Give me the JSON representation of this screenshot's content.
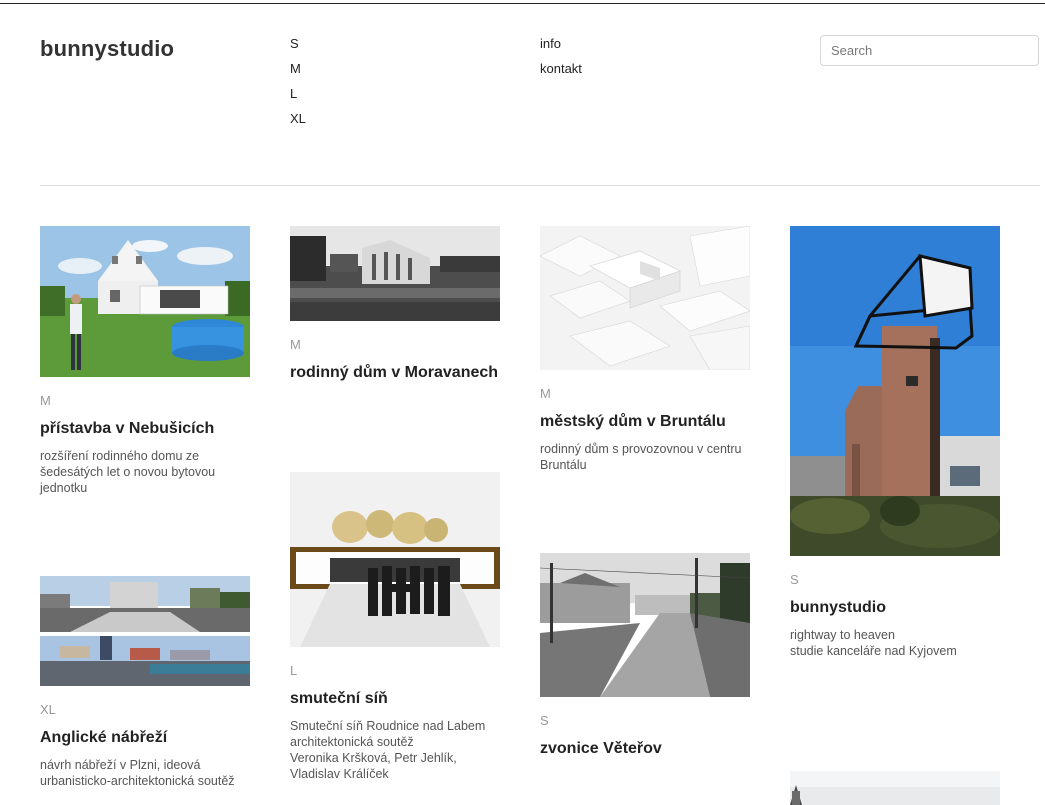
{
  "header": {
    "logo": "bunnystudio",
    "sizes_nav": [
      "S",
      "M",
      "L",
      "XL"
    ],
    "info_nav": [
      "info",
      "kontakt"
    ],
    "search_placeholder": "Search"
  },
  "projects": [
    {
      "size": "M",
      "title": "přístavba v Nebušicích",
      "description": "rozšíření rodinného domu ze šedesátých let o novou bytovou jednotku"
    },
    {
      "size": "M",
      "title": "rodinný dům v Moravanech",
      "description": ""
    },
    {
      "size": "M",
      "title": "městský dům v Bruntálu",
      "description": "rodinný dům s provozovnou v centru Bruntálu"
    },
    {
      "size": "S",
      "title": "bunnystudio",
      "description": "rightway to heaven\nstudie kanceláře nad Kyjovem"
    },
    {
      "size": "XL",
      "title": "Anglické nábřeží",
      "description": "návrh nábřeží v Plzni, ideová urbanisticko-architektonická soutěž"
    },
    {
      "size": "L",
      "title": "smuteční síň",
      "description": "Smuteční síň Roudnice nad Labem\narchitektonická soutěž\nVeronika Kršková, Petr Jehlík,\nVladislav Králíček"
    },
    {
      "size": "S",
      "title": "zvonice Věteřov",
      "description": ""
    }
  ],
  "colors": {
    "accent_text": "#222222",
    "muted_text": "#999999",
    "sky_blue": "#3f8fe0"
  }
}
